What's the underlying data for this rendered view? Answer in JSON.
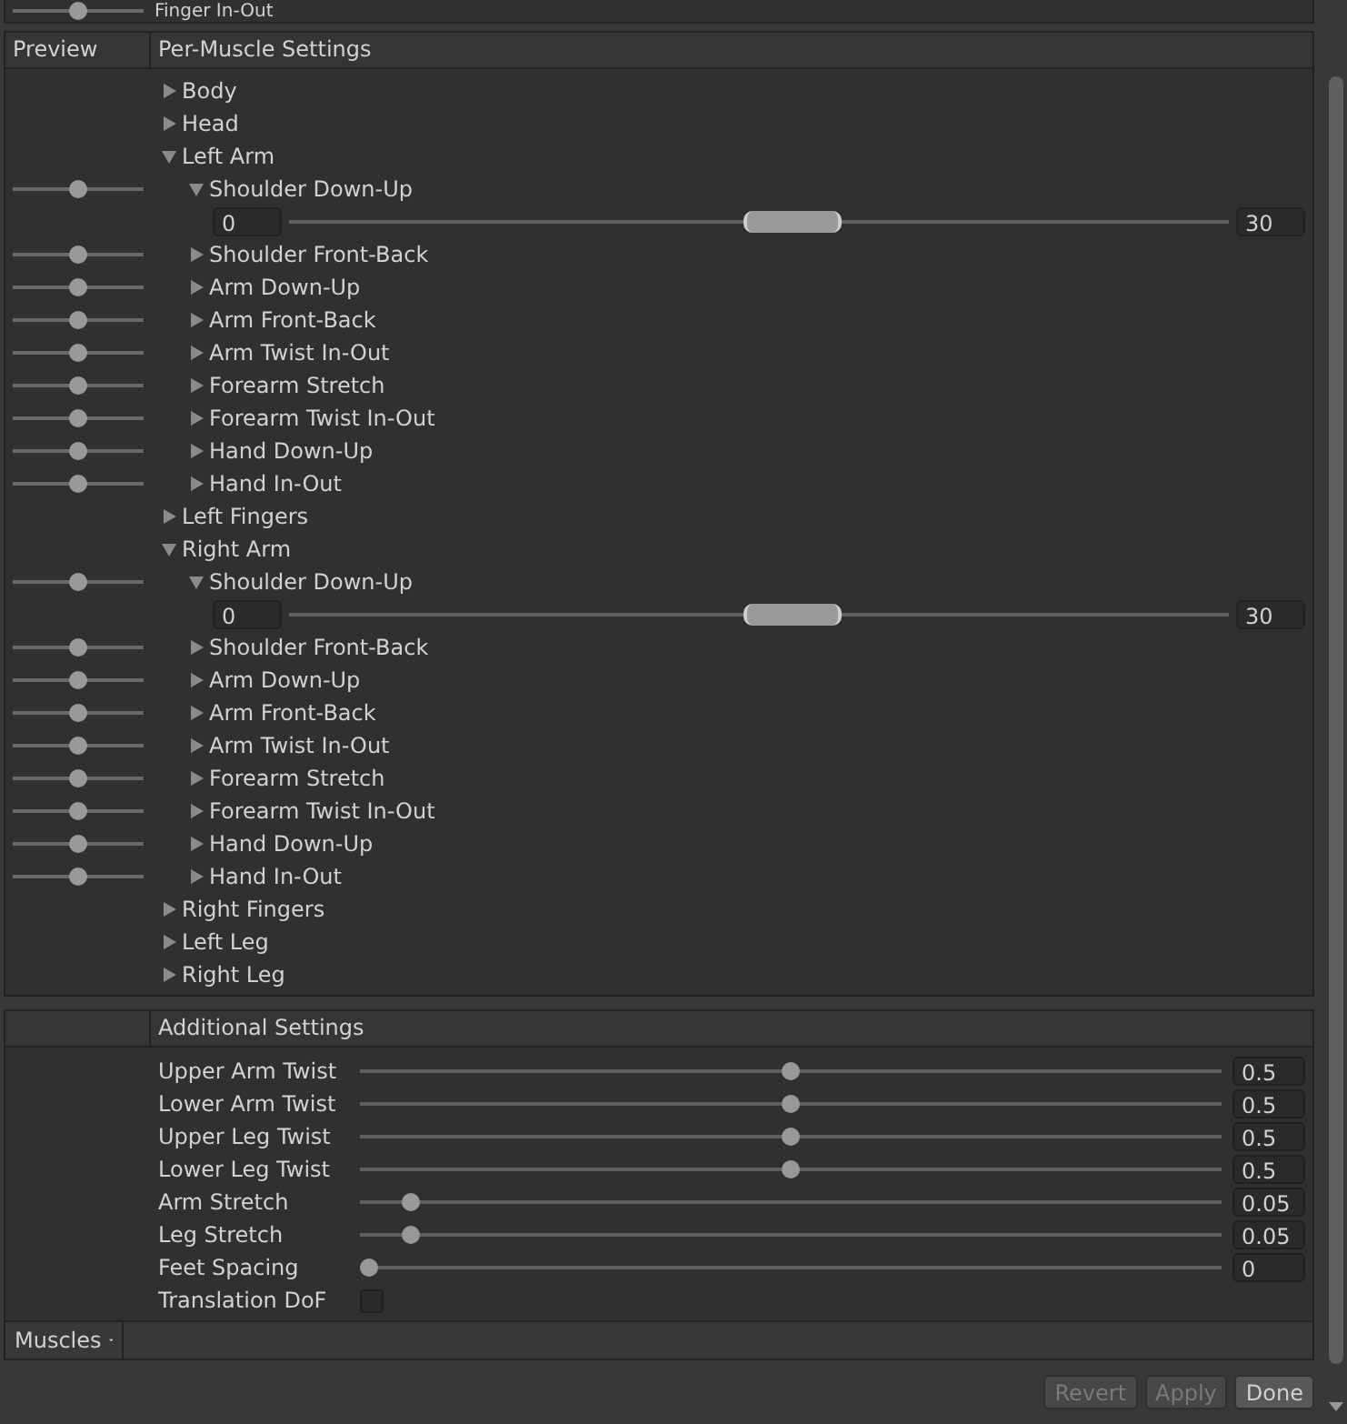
{
  "top_row": {
    "label": "Finger In-Out",
    "preview": {
      "level": 0.5
    }
  },
  "muscle_panel": {
    "preview_header": "Preview",
    "settings_header": "Per-Muscle Settings",
    "tree": [
      {
        "label": "Body",
        "expanded": false
      },
      {
        "label": "Head",
        "expanded": false
      },
      {
        "label": "Left Arm",
        "expanded": true,
        "children": [
          {
            "label": "Shoulder Down-Up",
            "expanded": true,
            "preview": {
              "level": 0.5
            },
            "range": {
              "min": "0",
              "max": "30",
              "level": 0.54
            }
          },
          {
            "label": "Shoulder Front-Back",
            "expanded": false,
            "preview": {
              "level": 0.5
            }
          },
          {
            "label": "Arm Down-Up",
            "expanded": false,
            "preview": {
              "level": 0.5
            }
          },
          {
            "label": "Arm Front-Back",
            "expanded": false,
            "preview": {
              "level": 0.5
            }
          },
          {
            "label": "Arm Twist In-Out",
            "expanded": false,
            "preview": {
              "level": 0.5
            }
          },
          {
            "label": "Forearm Stretch",
            "expanded": false,
            "preview": {
              "level": 0.5
            }
          },
          {
            "label": "Forearm Twist In-Out",
            "expanded": false,
            "preview": {
              "level": 0.5
            }
          },
          {
            "label": "Hand Down-Up",
            "expanded": false,
            "preview": {
              "level": 0.5
            }
          },
          {
            "label": "Hand In-Out",
            "expanded": false,
            "preview": {
              "level": 0.5
            }
          }
        ]
      },
      {
        "label": "Left Fingers",
        "expanded": false
      },
      {
        "label": "Right Arm",
        "expanded": true,
        "children": [
          {
            "label": "Shoulder Down-Up",
            "expanded": true,
            "preview": {
              "level": 0.5
            },
            "range": {
              "min": "0",
              "max": "30",
              "level": 0.54
            }
          },
          {
            "label": "Shoulder Front-Back",
            "expanded": false,
            "preview": {
              "level": 0.5
            }
          },
          {
            "label": "Arm Down-Up",
            "expanded": false,
            "preview": {
              "level": 0.5
            }
          },
          {
            "label": "Arm Front-Back",
            "expanded": false,
            "preview": {
              "level": 0.5
            }
          },
          {
            "label": "Arm Twist In-Out",
            "expanded": false,
            "preview": {
              "level": 0.5
            }
          },
          {
            "label": "Forearm Stretch",
            "expanded": false,
            "preview": {
              "level": 0.5
            }
          },
          {
            "label": "Forearm Twist In-Out",
            "expanded": false,
            "preview": {
              "level": 0.5
            }
          },
          {
            "label": "Hand Down-Up",
            "expanded": false,
            "preview": {
              "level": 0.5
            }
          },
          {
            "label": "Hand In-Out",
            "expanded": false,
            "preview": {
              "level": 0.5
            }
          }
        ]
      },
      {
        "label": "Right Fingers",
        "expanded": false
      },
      {
        "label": "Left Leg",
        "expanded": false
      },
      {
        "label": "Right Leg",
        "expanded": false
      }
    ]
  },
  "additional_panel": {
    "header": "Additional Settings",
    "settings": [
      {
        "kind": "slider",
        "label": "Upper Arm Twist",
        "level": 0.5,
        "value": "0.5"
      },
      {
        "kind": "slider",
        "label": "Lower Arm Twist",
        "level": 0.5,
        "value": "0.5"
      },
      {
        "kind": "slider",
        "label": "Upper Leg Twist",
        "level": 0.5,
        "value": "0.5"
      },
      {
        "kind": "slider",
        "label": "Lower Leg Twist",
        "level": 0.5,
        "value": "0.5"
      },
      {
        "kind": "slider",
        "label": "Arm Stretch",
        "level": 0.05,
        "value": "0.05"
      },
      {
        "kind": "slider",
        "label": "Leg Stretch",
        "level": 0.05,
        "value": "0.05"
      },
      {
        "kind": "slider",
        "label": "Feet Spacing",
        "level": 0,
        "value": "0"
      },
      {
        "kind": "checkbox",
        "label": "Translation DoF",
        "checked": false
      }
    ]
  },
  "footer": {
    "dropdown": "Muscles"
  },
  "buttons": [
    {
      "label": "Revert",
      "disabled": true
    },
    {
      "label": "Apply",
      "disabled": true
    },
    {
      "label": "Done",
      "disabled": false
    }
  ]
}
